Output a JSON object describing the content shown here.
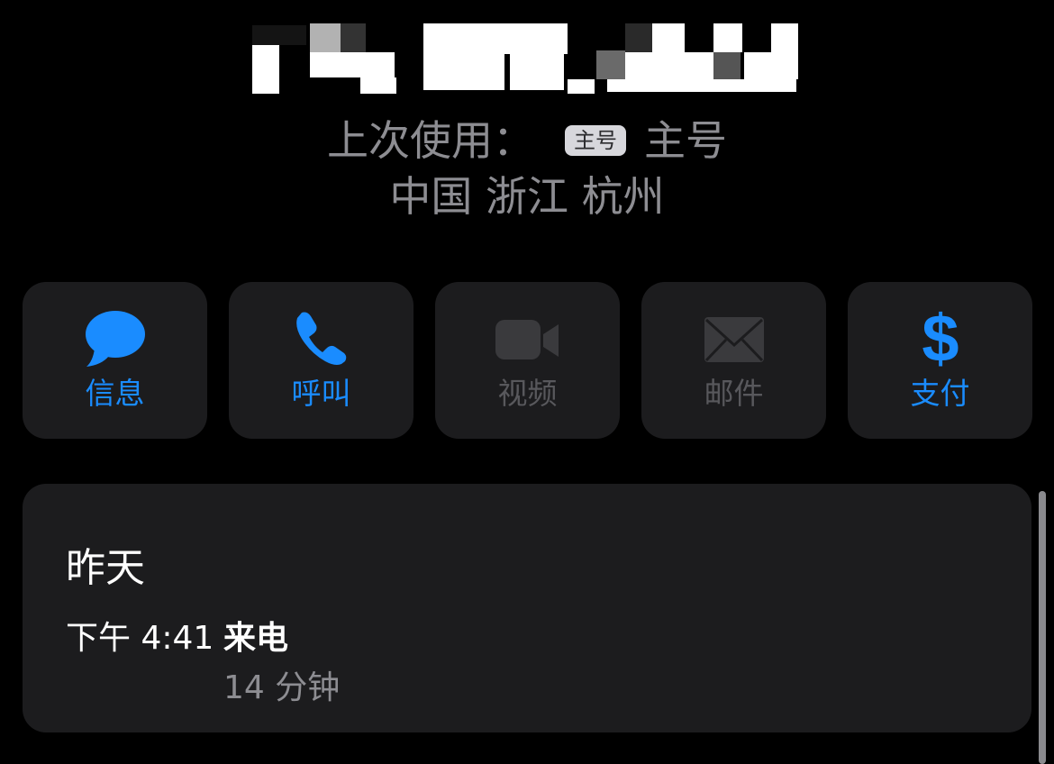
{
  "header": {
    "phone_number_redacted_label": "redacted phone number",
    "last_used_label": "上次使用：",
    "sim_badge": "主号",
    "sim_name": "主号",
    "location": "中国 浙江 杭州"
  },
  "actions": [
    {
      "label": "信息",
      "icon": "message-bubble-icon",
      "enabled": true
    },
    {
      "label": "呼叫",
      "icon": "phone-icon",
      "enabled": true
    },
    {
      "label": "视频",
      "icon": "video-camera-icon",
      "enabled": false
    },
    {
      "label": "邮件",
      "icon": "envelope-icon",
      "enabled": false
    },
    {
      "label": "支付",
      "icon": "dollar-icon",
      "enabled": true
    }
  ],
  "call_log": {
    "day": "昨天",
    "entries": [
      {
        "time": "下午 4:41",
        "type": "来电",
        "duration": "14 分钟"
      }
    ]
  },
  "colors": {
    "background": "#000000",
    "card": "#1c1c1e",
    "accent": "#1a8cff",
    "disabled": "#58585c",
    "secondary_text": "#8d8d92"
  }
}
